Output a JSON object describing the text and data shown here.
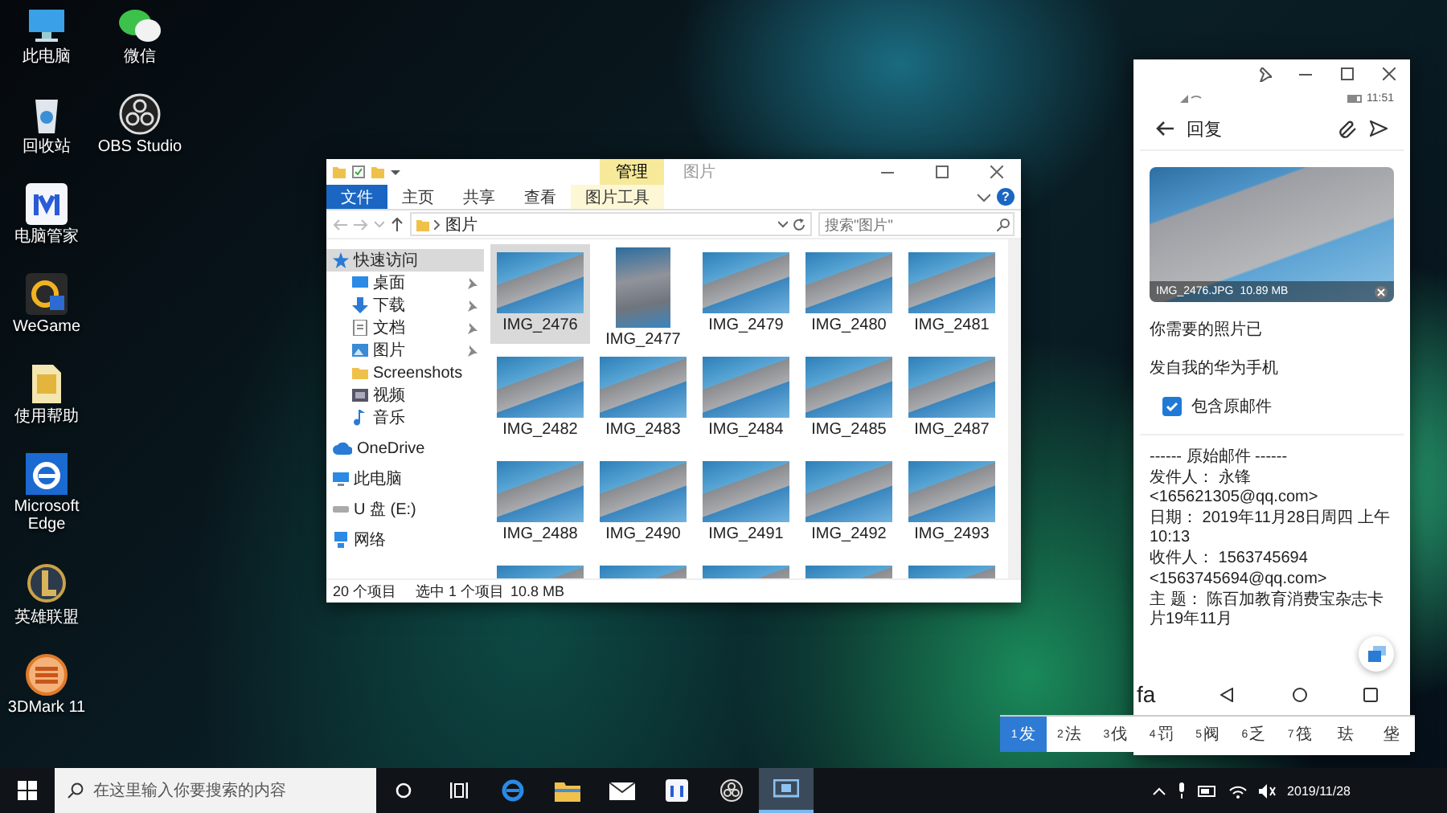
{
  "desktop_columns": [
    {
      "icons": [
        {
          "label": "此电脑",
          "kind": "computer"
        },
        {
          "label": "回收站",
          "kind": "recycle"
        },
        {
          "label": "电脑管家",
          "kind": "manager"
        },
        {
          "label": "WeGame",
          "kind": "wegame"
        },
        {
          "label": "使用帮助",
          "kind": "help"
        },
        {
          "label": "Microsoft Edge",
          "kind": "edge"
        },
        {
          "label": "英雄联盟",
          "kind": "game"
        },
        {
          "label": "3DMark 11",
          "kind": "mark"
        }
      ]
    },
    {
      "icons": [
        {
          "label": "微信",
          "kind": "chat"
        },
        {
          "label": "OBS Studio",
          "kind": "obs"
        }
      ]
    }
  ],
  "explorer": {
    "context_tab": "管理",
    "title": "图片",
    "ribbon_tabs": [
      {
        "label": "文件",
        "kind": "file"
      },
      {
        "label": "主页",
        "kind": "tab"
      },
      {
        "label": "共享",
        "kind": "tab"
      },
      {
        "label": "查看",
        "kind": "tab"
      },
      {
        "label": "图片工具",
        "kind": "context"
      }
    ],
    "help": "?",
    "breadcrumb": "图片",
    "search": {
      "placeholder": "搜索\"图片\""
    },
    "nav": [
      {
        "label": "快速访问",
        "kind": "star",
        "selected": true,
        "children": [
          {
            "label": "桌面",
            "kind": "desktop",
            "selected": false,
            "pinned": true
          },
          {
            "label": "下载",
            "kind": "download",
            "selected": false,
            "pinned": true
          },
          {
            "label": "文档",
            "kind": "document",
            "selected": false,
            "pinned": true
          },
          {
            "label": "图片",
            "kind": "picture",
            "selected": false,
            "pinned": true
          },
          {
            "label": "Screenshots",
            "kind": "folder",
            "selected": false,
            "pinned": false
          },
          {
            "label": "视频",
            "kind": "video",
            "selected": false,
            "pinned": false
          },
          {
            "label": "音乐",
            "kind": "music",
            "selected": false,
            "pinned": false
          }
        ]
      },
      {
        "label": "OneDrive",
        "kind": "cloud",
        "selected": false
      },
      {
        "label": "此电脑",
        "kind": "computer",
        "selected": false
      },
      {
        "label": "U 盘 (E:)",
        "kind": "drive",
        "selected": false
      },
      {
        "label": "网络",
        "kind": "network",
        "selected": false
      }
    ],
    "files": [
      {
        "label": "IMG_2476",
        "kind": "landscape",
        "selected": true
      },
      {
        "label": "IMG_2477",
        "kind": "portrait",
        "selected": false
      },
      {
        "label": "IMG_2479",
        "kind": "landscape",
        "selected": false
      },
      {
        "label": "IMG_2480",
        "kind": "landscape",
        "selected": false
      },
      {
        "label": "IMG_2481",
        "kind": "landscape",
        "selected": false
      },
      {
        "label": "IMG_2482",
        "kind": "landscape",
        "selected": false
      },
      {
        "label": "IMG_2483",
        "kind": "landscape",
        "selected": false
      },
      {
        "label": "IMG_2484",
        "kind": "landscape",
        "selected": false
      },
      {
        "label": "IMG_2485",
        "kind": "landscape",
        "selected": false
      },
      {
        "label": "IMG_2487",
        "kind": "landscape",
        "selected": false
      },
      {
        "label": "IMG_2488",
        "kind": "landscape",
        "selected": false
      },
      {
        "label": "IMG_2490",
        "kind": "landscape",
        "selected": false
      },
      {
        "label": "IMG_2491",
        "kind": "landscape",
        "selected": false
      },
      {
        "label": "IMG_2492",
        "kind": "landscape",
        "selected": false
      },
      {
        "label": "IMG_2493",
        "kind": "landscape",
        "selected": false
      },
      {
        "kind": "landscape",
        "selected": false
      },
      {
        "kind": "landscape",
        "selected": false
      },
      {
        "kind": "landscape",
        "selected": false
      },
      {
        "kind": "landscape",
        "selected": false
      },
      {
        "kind": "landscape",
        "selected": false
      }
    ],
    "status": {
      "count": "20 个项目",
      "selection": "选中 1 个项目",
      "size": "10.8 MB"
    }
  },
  "phone": {
    "time": "11:51",
    "title": "回复",
    "attachment": {
      "name": "IMG_2476.JPG",
      "size": "10.89 MB"
    },
    "body": [
      "你需要的照片已",
      "发自我的华为手机"
    ],
    "include_original": {
      "label": "包含原邮件",
      "checked": true
    },
    "quoted": [
      "------ 原始邮件 ------",
      "发件人： 永锋 <165621305@qq.com>",
      "日期： 2019年11月28日周四 上午10:13",
      "收件人： 1563745694",
      "<1563745694@qq.com>",
      "主 题： 陈百加教育消费宝杂志卡片19年11月"
    ],
    "composition": "fa"
  },
  "candidates": [
    {
      "index": "1",
      "text": "发",
      "selected": true
    },
    {
      "index": "2",
      "text": "法",
      "selected": false
    },
    {
      "index": "3",
      "text": "伐",
      "selected": false
    },
    {
      "index": "4",
      "text": "罚",
      "selected": false
    },
    {
      "index": "5",
      "text": "阀",
      "selected": false
    },
    {
      "index": "6",
      "text": "乏",
      "selected": false
    },
    {
      "index": "7",
      "text": "筏",
      "selected": false
    },
    {
      "text": "珐",
      "selected": false
    },
    {
      "text": "垡",
      "selected": false
    }
  ],
  "taskbar": {
    "search": {
      "placeholder": "在这里输入你要搜索的内容"
    },
    "apps": [
      {
        "kind": "edge",
        "selected": false
      },
      {
        "kind": "folder",
        "selected": false
      },
      {
        "kind": "mail",
        "selected": false
      },
      {
        "kind": "manager",
        "selected": false
      },
      {
        "kind": "obs",
        "selected": false
      },
      {
        "kind": "mirror",
        "selected": true
      }
    ],
    "date": "2019/11/28"
  }
}
